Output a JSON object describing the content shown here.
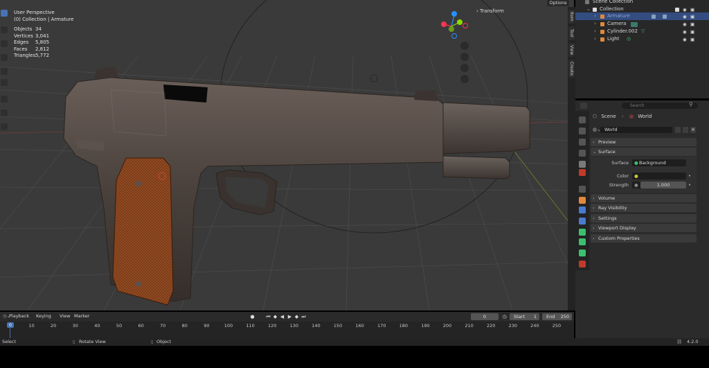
{
  "viewport": {
    "view_name": "User Perspective",
    "collection_path": "(0) Collection | Armature",
    "stats": [
      {
        "label": "Objects",
        "value": "34"
      },
      {
        "label": "Vertices",
        "value": "3,041"
      },
      {
        "label": "Edges",
        "value": "5,805"
      },
      {
        "label": "Faces",
        "value": "2,812"
      },
      {
        "label": "Triangles",
        "value": "5,772"
      }
    ],
    "transform_label": "Transform",
    "options_label": "Options",
    "side_tabs": [
      "Item",
      "Tool",
      "View",
      "Create"
    ],
    "gizmo_axes": [
      "X",
      "Y",
      "Z"
    ]
  },
  "outliner": {
    "scene_collection": "Scene Collection",
    "collection": "Collection",
    "items": [
      {
        "label": "Armature",
        "selected": true
      },
      {
        "label": "Camera",
        "selected": false
      },
      {
        "label": "Cylinder.002",
        "selected": false
      },
      {
        "label": "Light",
        "selected": false
      }
    ]
  },
  "properties": {
    "search_placeholder": "Search",
    "breadcrumb_scene": "Scene",
    "breadcrumb_world": "World",
    "world_name": "World",
    "panels": {
      "preview": "Preview",
      "surface": "Surface",
      "volume": "Volume",
      "ray_visibility": "Ray Visibility",
      "settings": "Settings",
      "viewport_display": "Viewport Display",
      "custom_properties": "Custom Properties"
    },
    "surface_label": "Surface",
    "surface_value": "Background",
    "color_label": "Color",
    "strength_label": "Strength",
    "strength_value": "1.000"
  },
  "timeline": {
    "menus": [
      "Playback",
      "Keying",
      "View",
      "Marker"
    ],
    "current_frame": "0",
    "start_label": "Start",
    "start_value": "1",
    "end_label": "End",
    "end_value": "250",
    "ticks": [
      "0",
      "10",
      "20",
      "30",
      "40",
      "50",
      "60",
      "70",
      "80",
      "90",
      "100",
      "110",
      "120",
      "130",
      "140",
      "150",
      "160",
      "170",
      "180",
      "190",
      "200",
      "210",
      "220",
      "230",
      "240",
      "250"
    ]
  },
  "statusbar": {
    "select": "Select",
    "rotate": "Rotate View",
    "object": "Object",
    "version": "4.2.0"
  },
  "colors": {
    "accent": "#4772b3",
    "selection": "#334d80",
    "x_axis": "#ff3352",
    "y_axis": "#8bdc00",
    "z_axis": "#2890ff"
  }
}
